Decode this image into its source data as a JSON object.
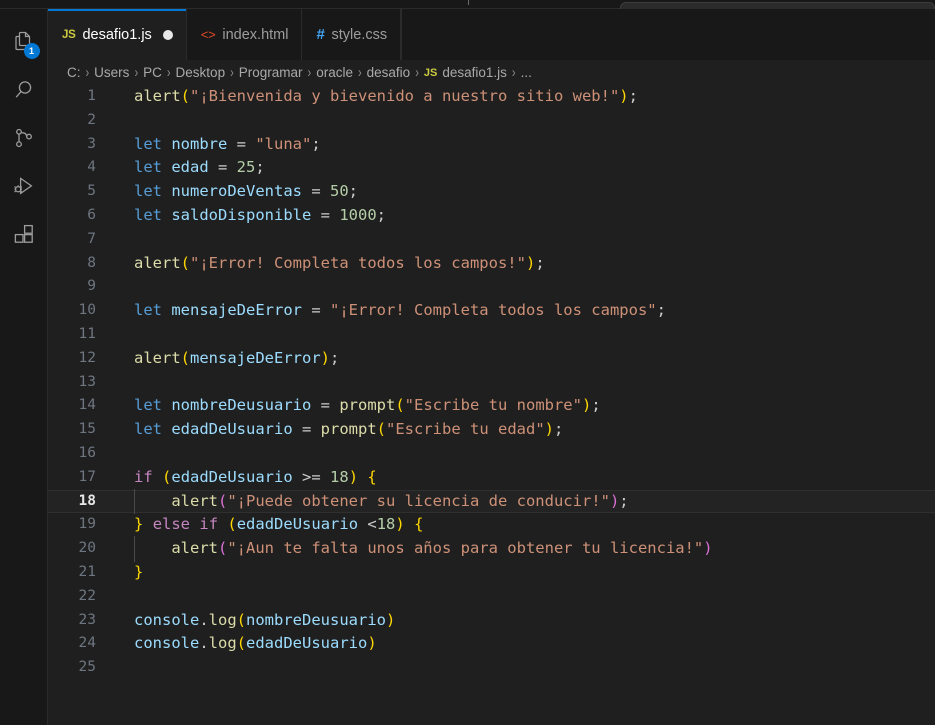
{
  "window": {
    "command_center_placeholder": ""
  },
  "activitybar": {
    "items": [
      {
        "name": "explorer",
        "icon": "files-icon",
        "badge": "1"
      },
      {
        "name": "search",
        "icon": "search-icon",
        "badge": ""
      },
      {
        "name": "source-control",
        "icon": "source-control-icon",
        "badge": ""
      },
      {
        "name": "run-and-debug",
        "icon": "run-debug-icon",
        "badge": ""
      },
      {
        "name": "extensions",
        "icon": "extensions-icon",
        "badge": ""
      }
    ]
  },
  "tabs": [
    {
      "label": "desafio1.js",
      "icon": "js-file-icon",
      "icon_glyph": "JS",
      "active": true,
      "dirty": true
    },
    {
      "label": "index.html",
      "icon": "html-file-icon",
      "icon_glyph": "<>",
      "active": false,
      "dirty": false
    },
    {
      "label": "style.css",
      "icon": "css-file-icon",
      "icon_glyph": "#",
      "active": false,
      "dirty": false
    }
  ],
  "breadcrumbs": {
    "items": [
      "C:",
      "Users",
      "PC",
      "Desktop",
      "Programar",
      "oracle",
      "desafio",
      "desafio1.js",
      "..."
    ],
    "file_icon_glyph": "JS",
    "file_index": 7,
    "separator": "›"
  },
  "editor": {
    "language": "javascript",
    "active_line": 18,
    "total_lines": 25,
    "first_line": 1,
    "lines": [
      {
        "n": 1,
        "indent": 0,
        "tokens": [
          {
            "t": "alert",
            "c": "t-fn"
          },
          {
            "t": "(",
            "c": "t-b1"
          },
          {
            "t": "\"¡Bienvenida y bievenido a nuestro sitio web!\"",
            "c": "t-str"
          },
          {
            "t": ")",
            "c": "t-b1"
          },
          {
            "t": ";",
            "c": "t-plain"
          }
        ]
      },
      {
        "n": 2,
        "indent": 0,
        "tokens": []
      },
      {
        "n": 3,
        "indent": 0,
        "tokens": [
          {
            "t": "let",
            "c": "t-kw"
          },
          {
            "t": " ",
            "c": "t-plain"
          },
          {
            "t": "nombre",
            "c": "t-var"
          },
          {
            "t": " = ",
            "c": "t-plain"
          },
          {
            "t": "\"luna\"",
            "c": "t-str"
          },
          {
            "t": ";",
            "c": "t-plain"
          }
        ]
      },
      {
        "n": 4,
        "indent": 0,
        "tokens": [
          {
            "t": "let",
            "c": "t-kw"
          },
          {
            "t": " ",
            "c": "t-plain"
          },
          {
            "t": "edad",
            "c": "t-var"
          },
          {
            "t": " = ",
            "c": "t-plain"
          },
          {
            "t": "25",
            "c": "t-num"
          },
          {
            "t": ";",
            "c": "t-plain"
          }
        ]
      },
      {
        "n": 5,
        "indent": 0,
        "tokens": [
          {
            "t": "let",
            "c": "t-kw"
          },
          {
            "t": " ",
            "c": "t-plain"
          },
          {
            "t": "numeroDeVentas",
            "c": "t-var"
          },
          {
            "t": " = ",
            "c": "t-plain"
          },
          {
            "t": "50",
            "c": "t-num"
          },
          {
            "t": ";",
            "c": "t-plain"
          }
        ]
      },
      {
        "n": 6,
        "indent": 0,
        "tokens": [
          {
            "t": "let",
            "c": "t-kw"
          },
          {
            "t": " ",
            "c": "t-plain"
          },
          {
            "t": "saldoDisponible",
            "c": "t-var"
          },
          {
            "t": " = ",
            "c": "t-plain"
          },
          {
            "t": "1000",
            "c": "t-num"
          },
          {
            "t": ";",
            "c": "t-plain"
          }
        ]
      },
      {
        "n": 7,
        "indent": 0,
        "tokens": []
      },
      {
        "n": 8,
        "indent": 0,
        "tokens": [
          {
            "t": "alert",
            "c": "t-fn"
          },
          {
            "t": "(",
            "c": "t-b1"
          },
          {
            "t": "\"¡Error! Completa todos los campos!\"",
            "c": "t-str"
          },
          {
            "t": ")",
            "c": "t-b1"
          },
          {
            "t": ";",
            "c": "t-plain"
          }
        ]
      },
      {
        "n": 9,
        "indent": 0,
        "tokens": []
      },
      {
        "n": 10,
        "indent": 0,
        "tokens": [
          {
            "t": "let",
            "c": "t-kw"
          },
          {
            "t": " ",
            "c": "t-plain"
          },
          {
            "t": "mensajeDeError",
            "c": "t-var"
          },
          {
            "t": " = ",
            "c": "t-plain"
          },
          {
            "t": "\"¡Error! Completa todos los campos\"",
            "c": "t-str"
          },
          {
            "t": ";",
            "c": "t-plain"
          }
        ]
      },
      {
        "n": 11,
        "indent": 0,
        "tokens": []
      },
      {
        "n": 12,
        "indent": 0,
        "tokens": [
          {
            "t": "alert",
            "c": "t-fn"
          },
          {
            "t": "(",
            "c": "t-b1"
          },
          {
            "t": "mensajeDeError",
            "c": "t-var"
          },
          {
            "t": ")",
            "c": "t-b1"
          },
          {
            "t": ";",
            "c": "t-plain"
          }
        ]
      },
      {
        "n": 13,
        "indent": 0,
        "tokens": []
      },
      {
        "n": 14,
        "indent": 0,
        "tokens": [
          {
            "t": "let",
            "c": "t-kw"
          },
          {
            "t": " ",
            "c": "t-plain"
          },
          {
            "t": "nombreDeusuario",
            "c": "t-var"
          },
          {
            "t": " = ",
            "c": "t-plain"
          },
          {
            "t": "prompt",
            "c": "t-fn"
          },
          {
            "t": "(",
            "c": "t-b1"
          },
          {
            "t": "\"Escribe tu nombre\"",
            "c": "t-str"
          },
          {
            "t": ")",
            "c": "t-b1"
          },
          {
            "t": ";",
            "c": "t-plain"
          }
        ]
      },
      {
        "n": 15,
        "indent": 0,
        "tokens": [
          {
            "t": "let",
            "c": "t-kw"
          },
          {
            "t": " ",
            "c": "t-plain"
          },
          {
            "t": "edadDeUsuario",
            "c": "t-var"
          },
          {
            "t": " = ",
            "c": "t-plain"
          },
          {
            "t": "prompt",
            "c": "t-fn"
          },
          {
            "t": "(",
            "c": "t-b1"
          },
          {
            "t": "\"Escribe tu edad\"",
            "c": "t-str"
          },
          {
            "t": ")",
            "c": "t-b1"
          },
          {
            "t": ";",
            "c": "t-plain"
          }
        ]
      },
      {
        "n": 16,
        "indent": 0,
        "tokens": []
      },
      {
        "n": 17,
        "indent": 0,
        "tokens": [
          {
            "t": "if",
            "c": "t-ctrl"
          },
          {
            "t": " ",
            "c": "t-plain"
          },
          {
            "t": "(",
            "c": "t-b1"
          },
          {
            "t": "edadDeUsuario",
            "c": "t-var"
          },
          {
            "t": " >= ",
            "c": "t-plain"
          },
          {
            "t": "18",
            "c": "t-num"
          },
          {
            "t": ")",
            "c": "t-b1"
          },
          {
            "t": " ",
            "c": "t-plain"
          },
          {
            "t": "{",
            "c": "t-b1"
          }
        ]
      },
      {
        "n": 18,
        "indent": 1,
        "tokens": [
          {
            "t": "    ",
            "c": "t-plain"
          },
          {
            "t": "alert",
            "c": "t-fn"
          },
          {
            "t": "(",
            "c": "t-b2"
          },
          {
            "t": "\"¡Puede obtener su licencia de conducir!\"",
            "c": "t-str"
          },
          {
            "t": ")",
            "c": "t-b2"
          },
          {
            "t": ";",
            "c": "t-plain"
          }
        ]
      },
      {
        "n": 19,
        "indent": 0,
        "tokens": [
          {
            "t": "}",
            "c": "t-b1"
          },
          {
            "t": " ",
            "c": "t-plain"
          },
          {
            "t": "else",
            "c": "t-ctrl"
          },
          {
            "t": " ",
            "c": "t-plain"
          },
          {
            "t": "if",
            "c": "t-ctrl"
          },
          {
            "t": " ",
            "c": "t-plain"
          },
          {
            "t": "(",
            "c": "t-b1"
          },
          {
            "t": "edadDeUsuario",
            "c": "t-var"
          },
          {
            "t": " <",
            "c": "t-plain"
          },
          {
            "t": "18",
            "c": "t-num"
          },
          {
            "t": ")",
            "c": "t-b1"
          },
          {
            "t": " ",
            "c": "t-plain"
          },
          {
            "t": "{",
            "c": "t-b1"
          }
        ]
      },
      {
        "n": 20,
        "indent": 1,
        "tokens": [
          {
            "t": "    ",
            "c": "t-plain"
          },
          {
            "t": "alert",
            "c": "t-fn"
          },
          {
            "t": "(",
            "c": "t-b2"
          },
          {
            "t": "\"¡Aun te falta unos años para obtener tu licencia!\"",
            "c": "t-str"
          },
          {
            "t": ")",
            "c": "t-b2"
          }
        ]
      },
      {
        "n": 21,
        "indent": 0,
        "tokens": [
          {
            "t": "}",
            "c": "t-b1"
          }
        ]
      },
      {
        "n": 22,
        "indent": 0,
        "tokens": []
      },
      {
        "n": 23,
        "indent": 0,
        "tokens": [
          {
            "t": "console",
            "c": "t-var"
          },
          {
            "t": ".",
            "c": "t-plain"
          },
          {
            "t": "log",
            "c": "t-fn"
          },
          {
            "t": "(",
            "c": "t-b1"
          },
          {
            "t": "nombreDeusuario",
            "c": "t-var"
          },
          {
            "t": ")",
            "c": "t-b1"
          }
        ]
      },
      {
        "n": 24,
        "indent": 0,
        "tokens": [
          {
            "t": "console",
            "c": "t-var"
          },
          {
            "t": ".",
            "c": "t-plain"
          },
          {
            "t": "log",
            "c": "t-fn"
          },
          {
            "t": "(",
            "c": "t-b1"
          },
          {
            "t": "edadDeUsuario",
            "c": "t-var"
          },
          {
            "t": ")",
            "c": "t-b1"
          }
        ]
      },
      {
        "n": 25,
        "indent": 0,
        "tokens": []
      }
    ]
  },
  "colors": {
    "accent": "#0078d4",
    "editor_bg": "#1f1f1f",
    "chrome_bg": "#181818",
    "badge_bg": "#0078d4",
    "active_line_bg": "#232323"
  }
}
